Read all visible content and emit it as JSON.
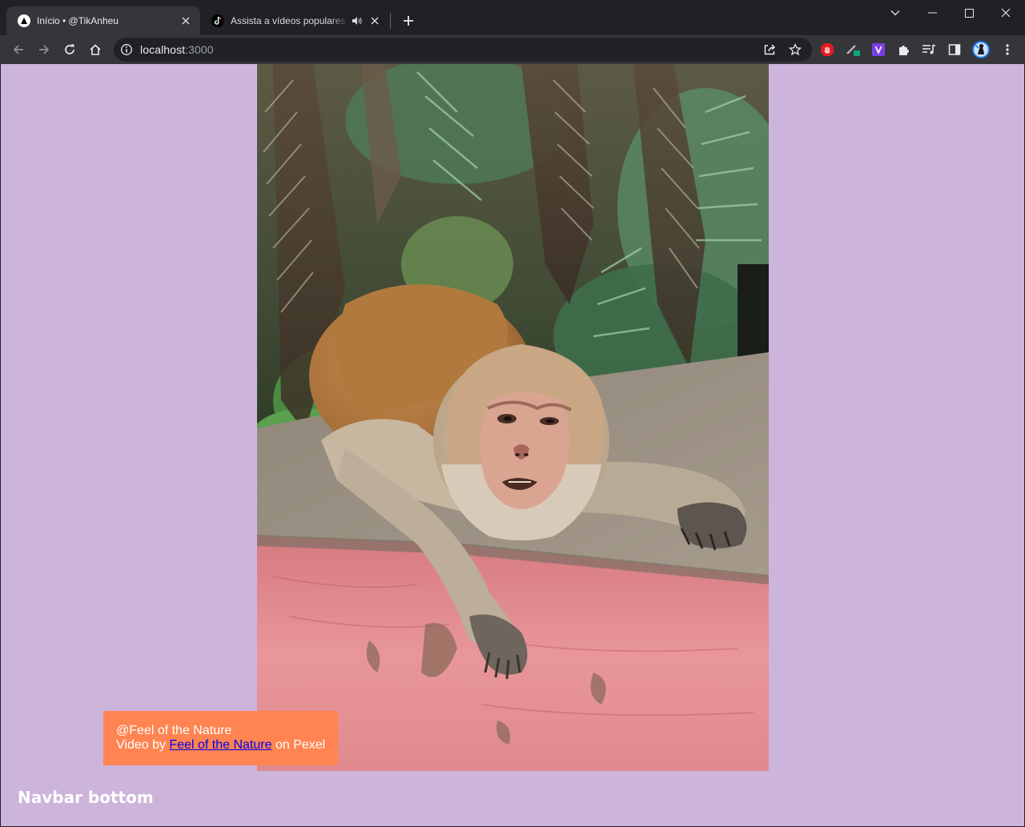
{
  "browser": {
    "tabs": [
      {
        "title": "Início • @TikAnheu",
        "active": true,
        "favicon": "nextjs-logo-icon"
      },
      {
        "title": "Assista a vídeos populares p",
        "active": false,
        "favicon": "tiktok-logo-icon",
        "audio": true
      }
    ],
    "address": {
      "host": "localhost",
      "port": ":3000"
    }
  },
  "page": {
    "video_alt": "Monkey lying on a pink-painted concrete ledge under palm fronds",
    "credit": {
      "handle": "@Feel of the Nature",
      "prefix": "Video by ",
      "author_link": "Feel of the Nature",
      "suffix": " on Pexel"
    },
    "navbar_bottom": "Navbar bottom",
    "colors": {
      "background": "#cdb4db",
      "credit_bg": "#ff8451",
      "link": "#0000ee"
    }
  }
}
